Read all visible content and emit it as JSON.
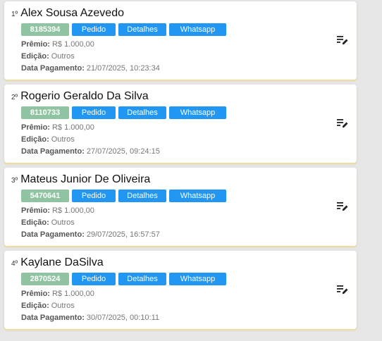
{
  "labels": {
    "premio": "Prêmio:",
    "edicao": "Edição:",
    "data_pagamento": "Data Pagamento:"
  },
  "buttons": {
    "pedido": "Pedido",
    "detalhes": "Detalhes",
    "whatsapp": "Whatsapp"
  },
  "icons": {
    "edit": "playlist-edit-icon"
  },
  "colors": {
    "code_badge": "#8fc3a1",
    "button": "#2196f3",
    "card_accent": "#efdc9c"
  },
  "winners": [
    {
      "rank": "1º",
      "name": "Alex Sousa Azevedo",
      "code": "8185394",
      "premio": "R$ 1.000,00",
      "edicao": "Outros",
      "data_pagamento": "21/07/2025, 10:23:34"
    },
    {
      "rank": "2º",
      "name": "Rogerio Geraldo Da Silva",
      "code": "8110733",
      "premio": "R$ 1.000,00",
      "edicao": "Outros",
      "data_pagamento": "27/07/2025, 09:24:15"
    },
    {
      "rank": "3º",
      "name": "Mateus Junior De Oliveira",
      "code": "5470641",
      "premio": "R$ 1.000,00",
      "edicao": "Outros",
      "data_pagamento": "29/07/2025, 16:57:57"
    },
    {
      "rank": "4º",
      "name": "Kaylane DaSilva",
      "code": "2870524",
      "premio": "R$ 1.000,00",
      "edicao": "Outros",
      "data_pagamento": "30/07/2025, 00:10:11"
    }
  ]
}
